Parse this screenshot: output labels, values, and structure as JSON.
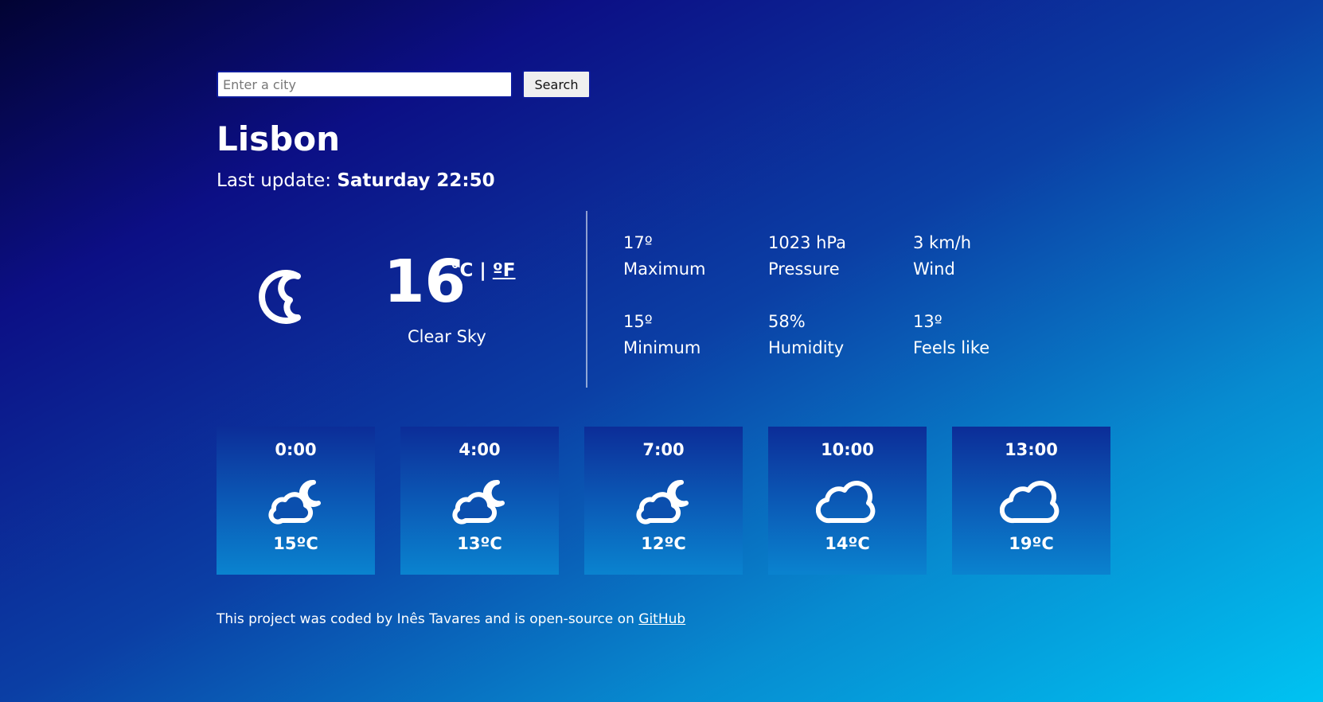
{
  "search": {
    "placeholder": "Enter a city",
    "value": "",
    "button_label": "Search"
  },
  "city": "Lisbon",
  "last_update": {
    "label": "Last update:",
    "value": "Saturday 22:50"
  },
  "current": {
    "icon": "moon-icon",
    "temperature": "16",
    "unit_c": "°C",
    "unit_sep": "|",
    "unit_f": "ºF",
    "description": "Clear Sky"
  },
  "stats": [
    {
      "value": "17º",
      "label": "Maximum"
    },
    {
      "value": "1023 hPa",
      "label": "Pressure"
    },
    {
      "value": "3 km/h",
      "label": "Wind"
    },
    {
      "value": "15º",
      "label": "Minimum"
    },
    {
      "value": "58%",
      "label": "Humidity"
    },
    {
      "value": "13º",
      "label": "Feels like"
    }
  ],
  "forecast": [
    {
      "time": "0:00",
      "icon": "cloud-moon-icon",
      "temp": "15ºC"
    },
    {
      "time": "4:00",
      "icon": "cloud-moon-icon",
      "temp": "13ºC"
    },
    {
      "time": "7:00",
      "icon": "cloud-moon-icon",
      "temp": "12ºC"
    },
    {
      "time": "10:00",
      "icon": "cloud-icon",
      "temp": "14ºC"
    },
    {
      "time": "13:00",
      "icon": "cloud-icon",
      "temp": "19ºC"
    }
  ],
  "footer": {
    "text": "This project was coded by Inês Tavares and is open-source on",
    "link_label": "GitHub"
  }
}
